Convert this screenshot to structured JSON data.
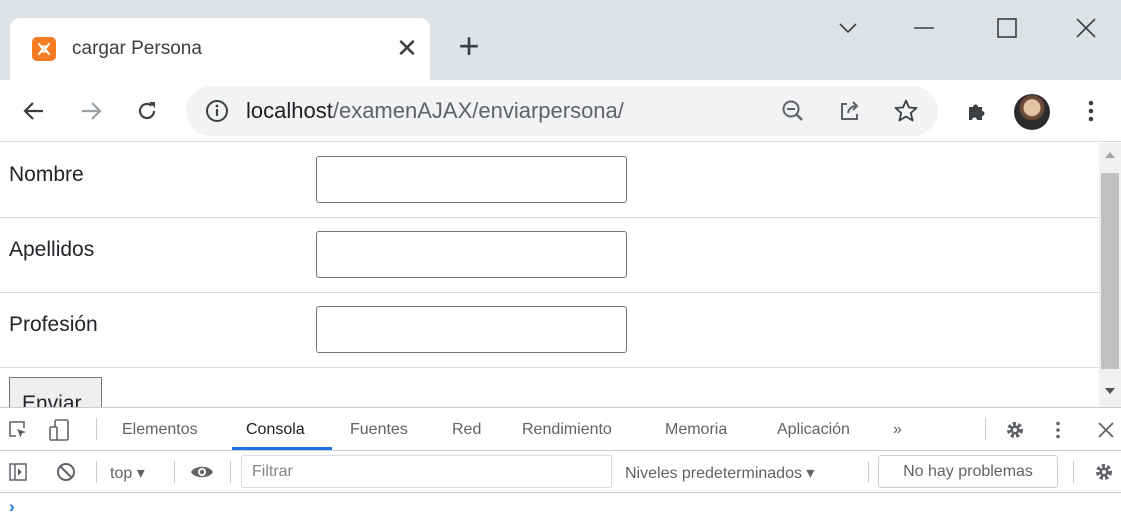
{
  "tab": {
    "title": "cargar Persona",
    "favicon_glyph": "ʘ",
    "close": "✕",
    "new_tab": "+"
  },
  "window": {
    "dropdown": "chevron-down-icon",
    "minimize": "minimize-icon",
    "maximize": "maximize-icon",
    "close": "close-icon"
  },
  "toolbar": {
    "url_host": "localhost",
    "url_path": "/examenAJAX/enviarpersona/",
    "info": "ⓘ"
  },
  "form": {
    "fields": [
      {
        "label": "Nombre",
        "value": ""
      },
      {
        "label": "Apellidos",
        "value": ""
      },
      {
        "label": "Profesión",
        "value": ""
      }
    ],
    "submit_label": "Enviar"
  },
  "devtools": {
    "tabs": [
      "Elementos",
      "Consola",
      "Fuentes",
      "Red",
      "Rendimiento",
      "Memoria",
      "Aplicación"
    ],
    "active_tab": "Consola",
    "more": "»",
    "context": "top ▾",
    "filter_placeholder": "Filtrar",
    "levels": "Niveles predeterminados ▾",
    "issues": "No hay problemas",
    "prompt": "›"
  },
  "colors": {
    "accent": "#1a73e8",
    "favicon": "#f57c23",
    "tabstrip": "#dee1e6"
  }
}
